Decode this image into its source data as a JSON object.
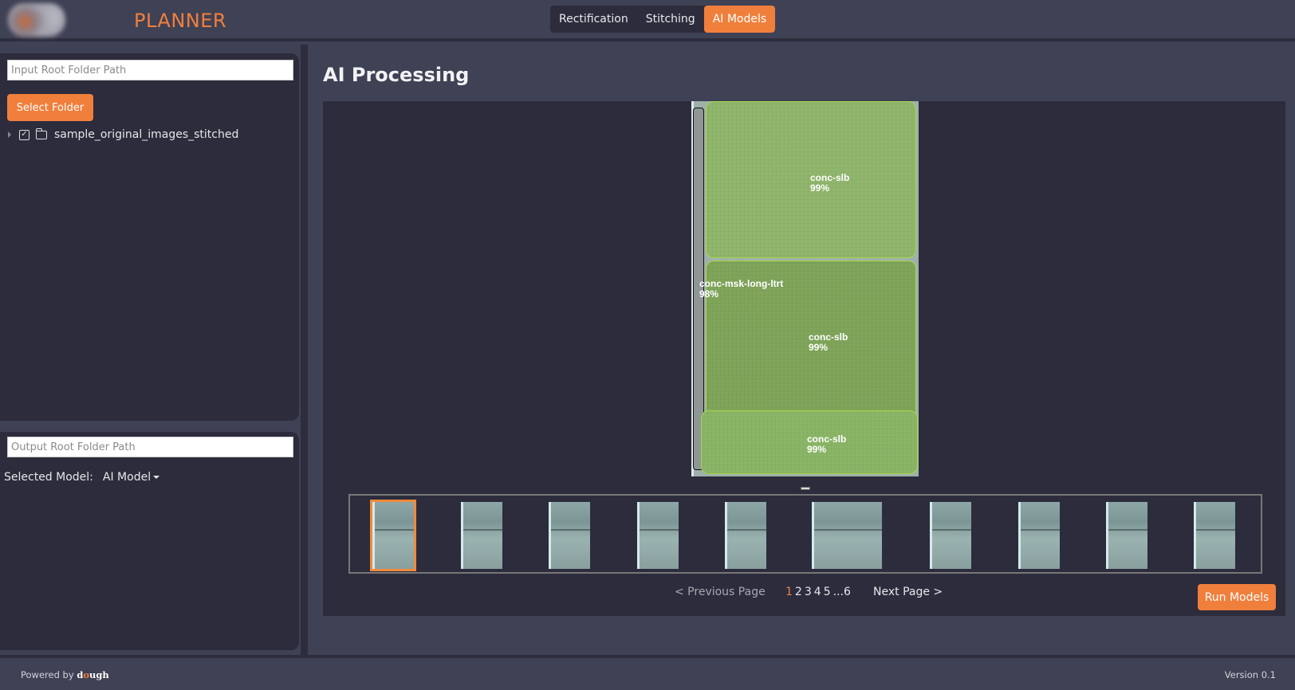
{
  "header": {
    "app_title": "PLANNER",
    "tabs": [
      {
        "label": "Rectification",
        "active": false
      },
      {
        "label": "Stitching",
        "active": false
      },
      {
        "label": "AI Models",
        "active": true
      }
    ]
  },
  "sidebar": {
    "input_path": {
      "placeholder": "Input Root Folder Path",
      "value": ""
    },
    "select_folder_label": "Select Folder",
    "tree": [
      {
        "name": "sample_original_images_stitched",
        "checked": true,
        "expanded": false
      }
    ],
    "output_path": {
      "placeholder": "Output Root Folder Path",
      "value": ""
    },
    "selected_model_label": "Selected Model:",
    "selected_model_value": "AI Model"
  },
  "main": {
    "title": "AI Processing",
    "detections": [
      {
        "class": "conc-slb",
        "confidence": "99%"
      },
      {
        "class": "conc-msk-long-ltrt",
        "confidence": "98%"
      },
      {
        "class": "conc-slb",
        "confidence": "99%"
      },
      {
        "class": "conc-slb",
        "confidence": "99%"
      }
    ],
    "thumbnail_count": 10,
    "selected_thumbnail": 1,
    "pagination": {
      "prev_label": "< Previous Page",
      "pages": [
        "1",
        "2",
        "3",
        "4",
        "5",
        "...6"
      ],
      "current_page": "1",
      "next_label": "Next Page >"
    },
    "run_models_label": "Run Models"
  },
  "footer": {
    "powered_by": "Powered by",
    "brand_d": "d",
    "brand_o": "o",
    "brand_rest": "ugh",
    "version": "Version 0.1"
  },
  "colors": {
    "accent": "#f07f3c",
    "background": "#3f4154",
    "panel": "#2c2c3c",
    "detection_mask": "#a7d64a"
  }
}
